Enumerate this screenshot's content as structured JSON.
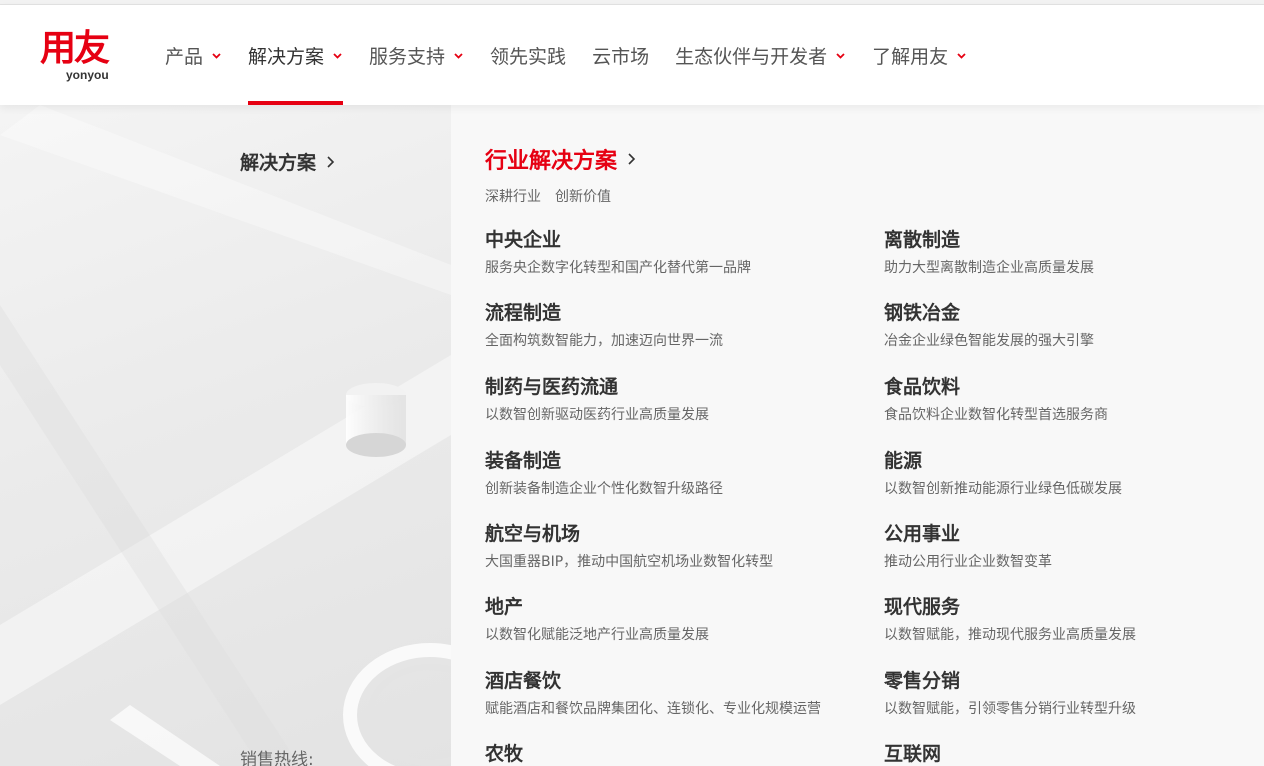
{
  "brand": {
    "logo_main": "用友",
    "logo_sub": "yonyou"
  },
  "nav": {
    "items": [
      {
        "label": "产品",
        "dropdown": true
      },
      {
        "label": "解决方案",
        "dropdown": true,
        "active": true
      },
      {
        "label": "服务支持",
        "dropdown": true
      },
      {
        "label": "领先实践",
        "dropdown": false
      },
      {
        "label": "云市场",
        "dropdown": false
      },
      {
        "label": "生态伙伴与开发者",
        "dropdown": true
      },
      {
        "label": "了解用友",
        "dropdown": true
      }
    ]
  },
  "left": {
    "title": "解决方案",
    "hotline_label": "销售热线:"
  },
  "section": {
    "title": "行业解决方案",
    "subtitle": "深耕行业　创新价值",
    "items": [
      {
        "name": "中央企业",
        "desc": "服务央企数字化转型和国产化替代第一品牌"
      },
      {
        "name": "离散制造",
        "desc": "助力大型离散制造企业高质量发展"
      },
      {
        "name": "流程制造",
        "desc": "全面构筑数智能力，加速迈向世界一流"
      },
      {
        "name": "钢铁冶金",
        "desc": "冶金企业绿色智能发展的强大引擎"
      },
      {
        "name": "制药与医药流通",
        "desc": "以数智创新驱动医药行业高质量发展"
      },
      {
        "name": "食品饮料",
        "desc": "食品饮料企业数智化转型首选服务商"
      },
      {
        "name": "装备制造",
        "desc": "创新装备制造企业个性化数智升级路径"
      },
      {
        "name": "能源",
        "desc": "以数智创新推动能源行业绿色低碳发展"
      },
      {
        "name": "航空与机场",
        "desc": "大国重器BIP，推动中国航空机场业数智化转型"
      },
      {
        "name": "公用事业",
        "desc": "推动公用行业企业数智变革"
      },
      {
        "name": "地产",
        "desc": "以数智化赋能泛地产行业高质量发展"
      },
      {
        "name": "现代服务",
        "desc": "以数智赋能，推动现代服务业高质量发展"
      },
      {
        "name": "酒店餐饮",
        "desc": "赋能酒店和餐饮品牌集团化、连锁化、专业化规模运营"
      },
      {
        "name": "零售分销",
        "desc": "以数智赋能，引领零售分销行业转型升级"
      },
      {
        "name": "农牧",
        "desc": ""
      },
      {
        "name": "互联网",
        "desc": ""
      }
    ]
  },
  "colors": {
    "accent": "#e60012",
    "text": "#333333",
    "muted": "#666666",
    "panel": "#f8f8f8"
  },
  "icons": {
    "nav_chevron": "chevron-down-icon",
    "title_arrow": "chevron-right-icon"
  }
}
